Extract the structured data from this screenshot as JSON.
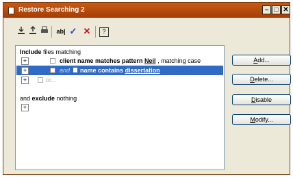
{
  "window": {
    "title": "Restore Searching 2"
  },
  "titlebar_buttons": {
    "minimize": "–",
    "maximize": "□",
    "close": "✕"
  },
  "toolbar": {
    "icons": [
      "import-icon",
      "export-icon",
      "print-icon",
      "rename-icon",
      "check-icon",
      "delete-icon",
      "help-icon"
    ],
    "rename_label": "ab|",
    "check_label": "✓",
    "delete_label": "✕",
    "help_label": "?"
  },
  "rules": {
    "include_word": "Include",
    "include_rest": " files matching",
    "row1": {
      "bold": "client name matches pattern ",
      "value": "Neil",
      "rest": " , matching case"
    },
    "row2": {
      "and": "and",
      "bold": " name contains ",
      "value": "dissertation"
    },
    "row3": {
      "or": "or..."
    },
    "exclude_pre": "and ",
    "exclude_word": "exclude",
    "exclude_rest": " nothing"
  },
  "buttons": {
    "add": "Add...",
    "delete": "Delete...",
    "disable": "Disable",
    "modify": "Modify..."
  },
  "colors": {
    "titlebar": "#c85a14",
    "selection": "#316ac5"
  }
}
